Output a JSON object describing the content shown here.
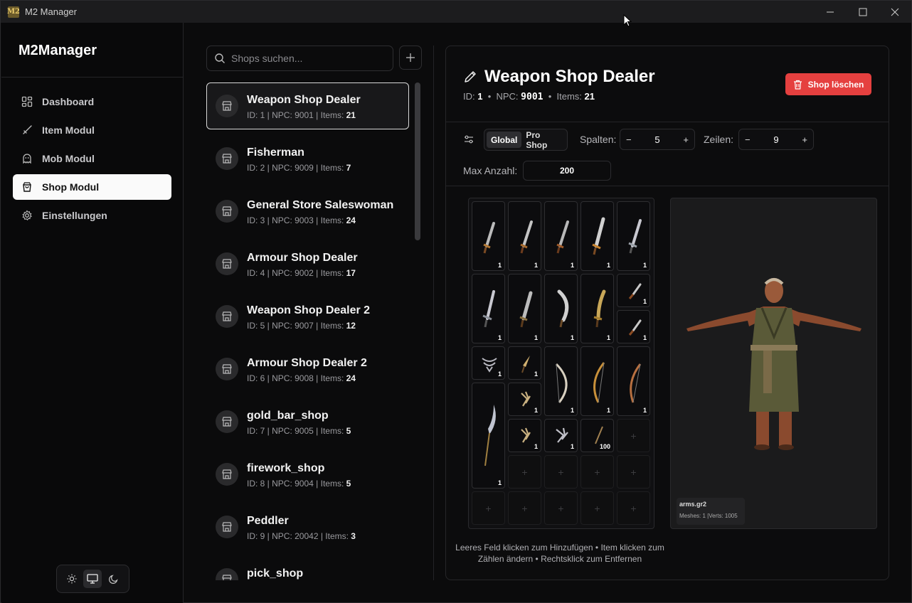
{
  "window": {
    "title": "M2 Manager",
    "app_icon_text": "M2"
  },
  "sidebar": {
    "brand": "M2Manager",
    "items": [
      {
        "label": "Dashboard",
        "icon": "dashboard-icon"
      },
      {
        "label": "Item Modul",
        "icon": "sword-icon"
      },
      {
        "label": "Mob Modul",
        "icon": "ghost-icon"
      },
      {
        "label": "Shop Modul",
        "icon": "shopping-bag-icon",
        "active": true
      },
      {
        "label": "Einstellungen",
        "icon": "gear-icon"
      }
    ],
    "theme": {
      "options": [
        "light",
        "system",
        "dark"
      ],
      "selected": "system"
    }
  },
  "shop_list": {
    "search_placeholder": "Shops suchen...",
    "shops": [
      {
        "name": "Weapon Shop Dealer",
        "meta": "ID: 1 | NPC: 9001 | Items: ",
        "items": "21",
        "active": true
      },
      {
        "name": "Fisherman",
        "meta": "ID: 2 | NPC: 9009 | Items: ",
        "items": "7"
      },
      {
        "name": "General Store Saleswoman",
        "meta": "ID: 3 | NPC: 9003 | Items: ",
        "items": "24"
      },
      {
        "name": "Armour Shop Dealer",
        "meta": "ID: 4 | NPC: 9002 | Items: ",
        "items": "17"
      },
      {
        "name": "Weapon Shop Dealer 2",
        "meta": "ID: 5 | NPC: 9007 | Items: ",
        "items": "12"
      },
      {
        "name": "Armour Shop Dealer 2",
        "meta": "ID: 6 | NPC: 9008 | Items: ",
        "items": "24"
      },
      {
        "name": "gold_bar_shop",
        "meta": "ID: 7 | NPC: 9005 | Items: ",
        "items": "5"
      },
      {
        "name": "firework_shop",
        "meta": "ID: 8 | NPC: 9004 | Items: ",
        "items": "5"
      },
      {
        "name": "Peddler",
        "meta": "ID: 9 | NPC: 20042 | Items: ",
        "items": "3"
      },
      {
        "name": "pick_shop",
        "meta": "",
        "items": ""
      }
    ]
  },
  "detail": {
    "title": "Weapon Shop Dealer",
    "id_label": "ID:",
    "id": "1",
    "npc_label": "NPC:",
    "npc": "9001",
    "items_label": "Items:",
    "items": "21",
    "delete_label": "Shop löschen",
    "toggle": {
      "options": [
        "Global",
        "Pro Shop"
      ],
      "selected": "Global"
    },
    "columns_label": "Spalten:",
    "columns": "5",
    "rows_label": "Zeilen:",
    "rows": "9",
    "max_label": "Max Anzahl:",
    "max": "200",
    "preview": {
      "file": "arms.gr2",
      "stats": "Meshes: 1 |Verts: 1005"
    },
    "help_text": "Leeres Feld klicken zum Hinzufügen • Item klicken zum Zählen ändern • Rechtsklick zum Entfernen",
    "grid_items": [
      {
        "icon": "sword-icon",
        "count": "1"
      },
      {
        "icon": "sword-icon",
        "count": "1"
      },
      {
        "icon": "sword-icon",
        "count": "1"
      },
      {
        "icon": "sword-icon",
        "count": "1"
      },
      {
        "icon": "sword-icon",
        "count": "1"
      },
      {
        "icon": "sword-icon",
        "count": "1"
      },
      {
        "icon": "sword-icon",
        "count": "1"
      },
      {
        "icon": "curved-blade-icon",
        "count": "1"
      },
      {
        "icon": "curved-blade-icon",
        "count": "1"
      },
      {
        "icon": "dagger-icon",
        "count": "1"
      },
      {
        "icon": "dagger-icon",
        "count": "1"
      },
      {
        "icon": "fan-icon",
        "count": "1"
      },
      {
        "icon": "arrowhead-icon",
        "count": "1"
      },
      {
        "icon": "bow-icon",
        "count": "1"
      },
      {
        "icon": "bow-icon",
        "count": "1"
      },
      {
        "icon": "bow-icon",
        "count": "1"
      },
      {
        "icon": "glaive-icon",
        "count": "1"
      },
      {
        "icon": "claw-icon",
        "count": "1"
      },
      {
        "icon": "claw-icon",
        "count": "1"
      },
      {
        "icon": "claw-icon",
        "count": "1"
      },
      {
        "icon": "arrow-icon",
        "count": "100"
      }
    ],
    "empty_slot_icon": "+"
  }
}
